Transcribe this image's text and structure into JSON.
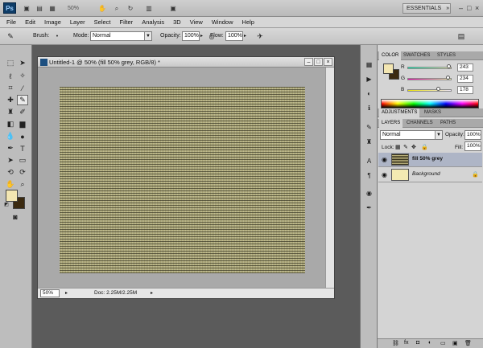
{
  "app": {
    "logo": "Ps",
    "zoom": "50%",
    "workspace": "ESSENTIALS",
    "window_controls": [
      "–",
      "□",
      "×"
    ]
  },
  "menu": [
    "File",
    "Edit",
    "Image",
    "Layer",
    "Select",
    "Filter",
    "Analysis",
    "3D",
    "View",
    "Window",
    "Help"
  ],
  "options": {
    "brush_label": "Brush:",
    "mode_label": "Mode:",
    "mode_value": "Normal",
    "opacity_label": "Opacity:",
    "opacity_value": "100%",
    "flow_label": "Flow:",
    "flow_value": "100%"
  },
  "tools": {
    "icons": [
      "move-tool-icon",
      "marquee-tool-icon",
      "lasso-tool-icon",
      "quick-select-icon",
      "crop-tool-icon",
      "eyedropper-icon",
      "healing-brush-icon",
      "brush-tool-icon",
      "clone-stamp-icon",
      "history-brush-icon",
      "eraser-icon",
      "gradient-icon",
      "blur-icon",
      "dodge-icon",
      "pen-icon",
      "type-icon",
      "path-select-icon",
      "shape-icon",
      "3d-rotate-icon",
      "3d-orbit-icon",
      "hand-icon",
      "zoom-icon"
    ],
    "foreground_color": "#f3e6b2",
    "background_color": "#3b2a10"
  },
  "document": {
    "title": "Untitled-1 @ 50% (fill 50% grey, RGB/8) *",
    "zoom": "50%",
    "doc_info": "Doc: 2.25M/2.25M"
  },
  "color_panel": {
    "tabs": [
      "COLOR",
      "SWATCHES",
      "STYLES"
    ],
    "channels": [
      {
        "name": "R",
        "value": "243",
        "level": 0.95
      },
      {
        "name": "G",
        "value": "234",
        "level": 0.92
      },
      {
        "name": "B",
        "value": "178",
        "level": 0.7
      }
    ]
  },
  "adjustments_panel": {
    "tabs": [
      "ADJUSTMENTS",
      "MASKS"
    ]
  },
  "layers_panel": {
    "tabs": [
      "LAYERS",
      "CHANNELS",
      "PATHS"
    ],
    "blend_mode": "Normal",
    "opacity_label": "Opacity:",
    "opacity_value": "100%",
    "lock_label": "Lock:",
    "fill_label": "Fill:",
    "fill_value": "100%",
    "layers": [
      {
        "name": "fill 50% grey",
        "selected": true
      },
      {
        "name": "Background",
        "selected": false
      }
    ]
  }
}
